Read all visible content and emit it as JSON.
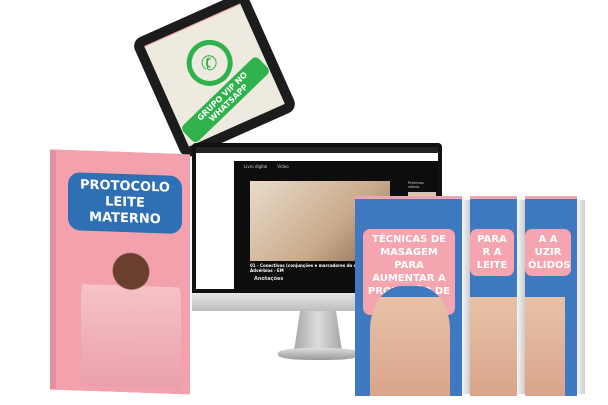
{
  "tablet": {
    "label": "GRUPO VIP NO WHATSAPP",
    "icon": "whatsapp-icon",
    "brand_color": "#2fb24c"
  },
  "monitor": {
    "tabs": [
      "Livro digital",
      "Vídeo"
    ],
    "up_next": "Próximos vídeos",
    "video_caption": "01 - Conectivos (conjunções e marcadores do discurso). Advérbios - EM",
    "notes": "Anotações"
  },
  "books": {
    "left": {
      "title": "PROTOCOLO LEITE MATERNO",
      "color": "#f3a2ad",
      "label_color": "#2f6fb3"
    },
    "right": [
      {
        "title": "TÉCNICAS DE MASAGEM PARA AUMENTAR A PRODUÇÃO DE LEITE"
      },
      {
        "title": "PARA R A LEITE"
      },
      {
        "title": "A A UZIR ÓLIDOS"
      }
    ],
    "right_color": "#3f7ac0",
    "right_label_color": "#f4a5b0"
  }
}
